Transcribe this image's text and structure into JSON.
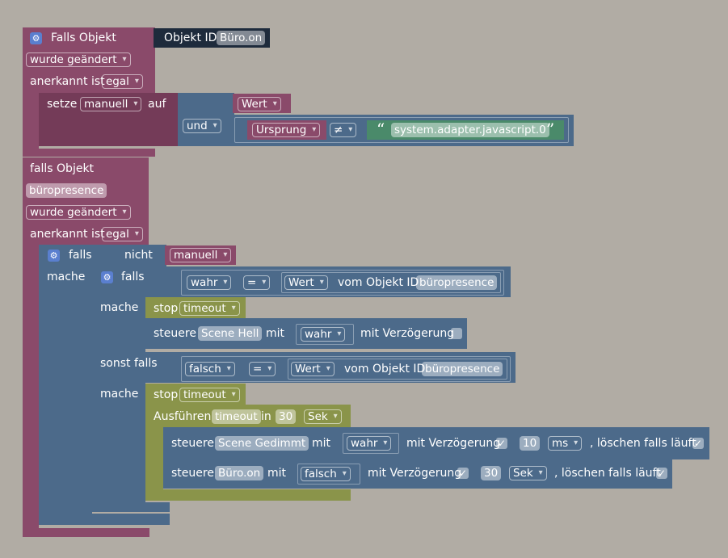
{
  "ev1": {
    "title": "Falls Objekt",
    "objekt_id_label": "Objekt ID",
    "objekt_id_value": "Büro.on",
    "changed_dd": "wurde geändert",
    "ack_label": "anerkannt ist",
    "ack_dd": "egal",
    "setze_label": "setze",
    "setze_var_dd": "manuell",
    "auf_label": "auf",
    "wert_dd": "Wert",
    "und_dd": "und",
    "ursprung_dd": "Ursprung",
    "neq_dd": "≠",
    "quote_open": "“",
    "adapter_text": "system.adapter.javascript.0",
    "quote_close": "”"
  },
  "ev2": {
    "title": "falls Objekt",
    "object_value": "büropresence",
    "changed_dd": "wurde geändert",
    "ack_label": "anerkannt ist",
    "ack_dd": "egal"
  },
  "if_outer": {
    "falls_label": "falls",
    "nicht_label": "nicht",
    "manuell_dd": "manuell",
    "mache_label": "mache"
  },
  "if_inner": {
    "falls_label": "falls",
    "wahr_dd": "wahr",
    "eq_dd": "=",
    "wert_dd": "Wert",
    "vom_label": "vom Objekt ID",
    "vom_value": "büropresence",
    "mache_label": "mache",
    "stop_label": "stop",
    "timeout_dd": "timeout",
    "steuere_label": "steuere",
    "scene_hell": "Scene Hell",
    "mit_label": "mit",
    "wahr2_dd": "wahr",
    "mit_verz_label": "mit Verzögerung",
    "sonst_label": "sonst falls",
    "falsch_dd": "falsch",
    "eq2_dd": "=",
    "wert2_dd": "Wert",
    "vom2_label": "vom Objekt ID",
    "vom2_value": "büropresence",
    "mache2_label": "mache",
    "stop2_label": "stop",
    "timeout2_dd": "timeout",
    "ausfuehren_label": "Ausführen",
    "timeout_field": "timeout",
    "in_label": "in",
    "in_value": "30",
    "sek_dd": "Sek",
    "row1_steuere": "steuere",
    "row1_target": "Scene Gedimmt",
    "row1_mit": "mit",
    "row1_val_dd": "wahr",
    "row1_mit_verz": "mit Verzögerung",
    "row1_check": "✓",
    "row1_delay": "10",
    "row1_unit_dd": "ms",
    "row1_loeschen": ", löschen falls läuft",
    "row1_check2": "✓",
    "row2_steuere": "steuere",
    "row2_target": "Büro.on",
    "row2_mit": "mit",
    "row2_val_dd": "falsch",
    "row2_mit_verz": "mit Verzögerung",
    "row2_check": "✓",
    "row2_delay": "30",
    "row2_unit_dd": "Sek",
    "row2_loeschen": ", löschen falls läuft",
    "row2_check2": "✓"
  },
  "colors": {
    "background": "#b1aca4",
    "event_block": "#8a4a6a",
    "logic_block": "#4c6a8a",
    "timer_block": "#8a944a",
    "text_block": "#4a8a6a",
    "object_block": "#1e2b3c"
  }
}
